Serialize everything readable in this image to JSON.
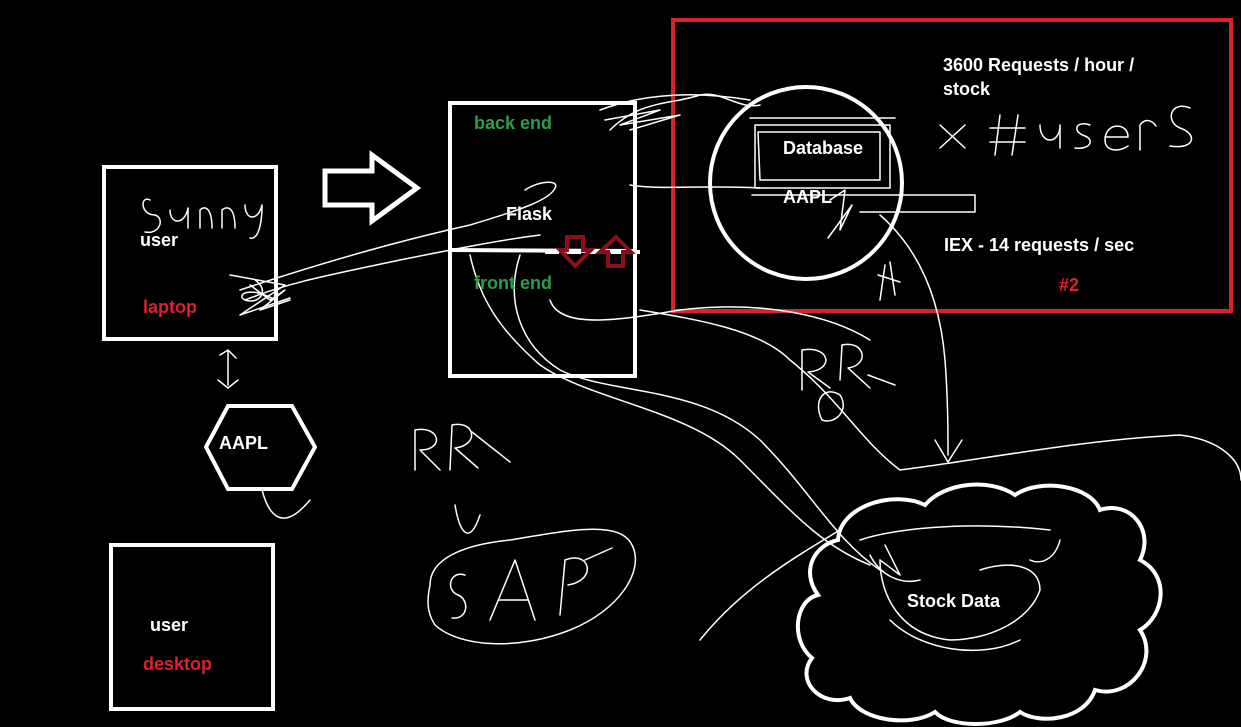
{
  "colors": {
    "background": "#000000",
    "stroke": "#ffffff",
    "label_white": "#ffffff",
    "label_green": "#2e9e45",
    "label_red": "#e0202a",
    "highlight_box": "#d8232a",
    "arrow_dark_red": "#8b0f1a"
  },
  "laptop": {
    "title": "user",
    "device": "laptop",
    "scribble": "Sunny"
  },
  "ticker_hexagon": {
    "label": "AAPL"
  },
  "desktop": {
    "title": "user",
    "device": "desktop"
  },
  "server": {
    "back_end": "back end",
    "flask": "Flask",
    "front_end": "front end"
  },
  "database": {
    "title": "Database",
    "ticker": "AAPL"
  },
  "notes": {
    "requests_per_hour": "3600 Requests / hour /",
    "requests_per_hour_line2": "stock",
    "times_users_scribble": "x #users",
    "iex_rate": "IEX - 14 requests / sec",
    "tag": "#2"
  },
  "stock_cloud": {
    "label": "Stock Data"
  },
  "scribbles": {
    "rr_left": "RR",
    "rr_right": "RR",
    "sap": "SAP"
  }
}
